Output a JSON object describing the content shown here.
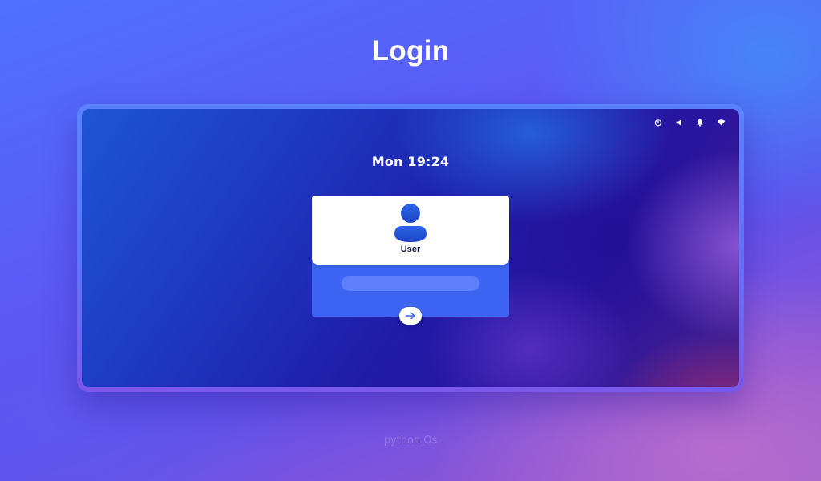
{
  "header": {
    "title": "Login"
  },
  "screen": {
    "clock": "Mon 19:24",
    "tray": {
      "icons": [
        "power-icon",
        "volume-icon",
        "notification-bell-icon",
        "wifi-icon"
      ]
    },
    "login": {
      "username": "User",
      "password": {
        "value": "",
        "placeholder": ""
      },
      "submit_icon": "arrow-right-icon"
    }
  },
  "footer": {
    "text": "python Os"
  },
  "colors": {
    "card_accent": "#3d63f3",
    "input_fill": "#5f80fb",
    "avatar": "#1f52d8"
  }
}
